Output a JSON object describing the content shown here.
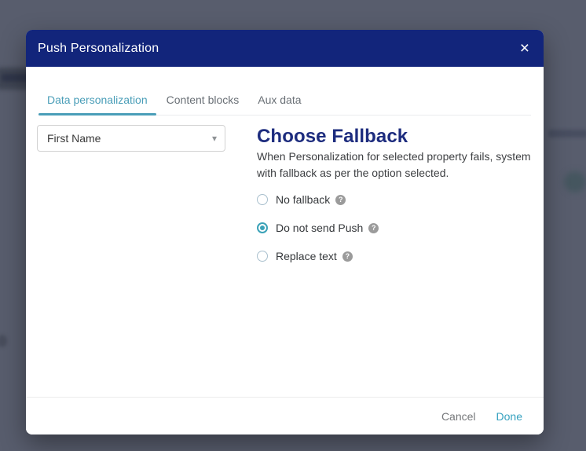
{
  "modal": {
    "title": "Push Personalization",
    "tabs": [
      {
        "label": "Data personalization",
        "active": true
      },
      {
        "label": "Content blocks",
        "active": false
      },
      {
        "label": "Aux data",
        "active": false
      }
    ],
    "property_dropdown": {
      "value": "First Name"
    },
    "fallback": {
      "heading": "Choose Fallback",
      "description_lines": [
        "When Personalization for selected property fails, system",
        "with fallback as per the option selected."
      ],
      "options": [
        {
          "label": "No fallback",
          "selected": false
        },
        {
          "label": "Do not send Push",
          "selected": true
        },
        {
          "label": "Replace text",
          "selected": false
        }
      ]
    },
    "footer": {
      "cancel_label": "Cancel",
      "done_label": "Done"
    }
  },
  "icons": {
    "close": "×",
    "caret_down": "▾",
    "help": "?"
  },
  "colors": {
    "header_navy": "#12257b",
    "heading_navy": "#1d2c7e",
    "accent_teal": "#4a9eb8",
    "radio_teal": "#3ba2b8",
    "done_teal": "#35a1bf",
    "overlay": "#585d6d"
  }
}
